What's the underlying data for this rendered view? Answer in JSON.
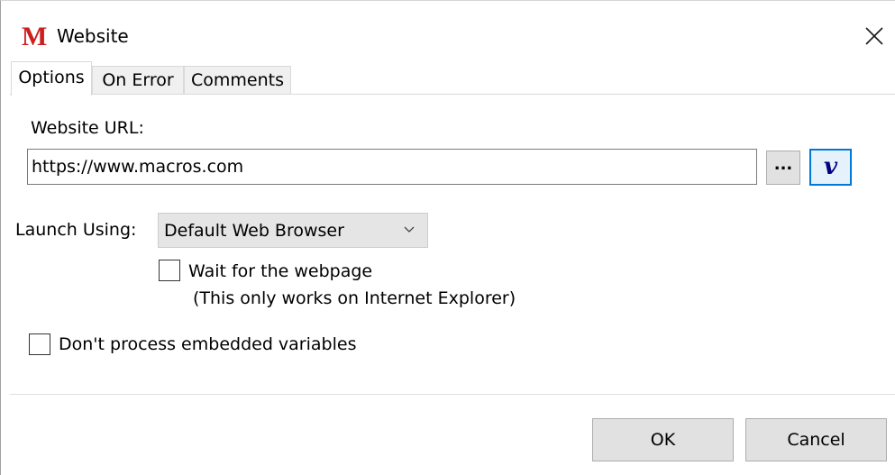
{
  "window": {
    "app_icon_letter": "M",
    "title": "Website",
    "close_icon": "close-icon"
  },
  "tabs": [
    {
      "label": "Options",
      "active": true
    },
    {
      "label": "On Error",
      "active": false
    },
    {
      "label": "Comments",
      "active": false
    }
  ],
  "url": {
    "label": "Website URL:",
    "value": "https://www.macros.com",
    "browse_label": "...",
    "variable_label": "v"
  },
  "launch": {
    "label": "Launch Using:",
    "selected": "Default Web Browser"
  },
  "wait_option": {
    "checked": false,
    "label": "Wait for the webpage",
    "note": "(This only works on Internet Explorer)"
  },
  "embedded_option": {
    "checked": false,
    "label": "Don't process embedded variables"
  },
  "buttons": {
    "ok": "OK",
    "cancel": "Cancel"
  },
  "colors": {
    "icon_red": "#cc1f1f",
    "focus_blue": "#0078d7"
  }
}
